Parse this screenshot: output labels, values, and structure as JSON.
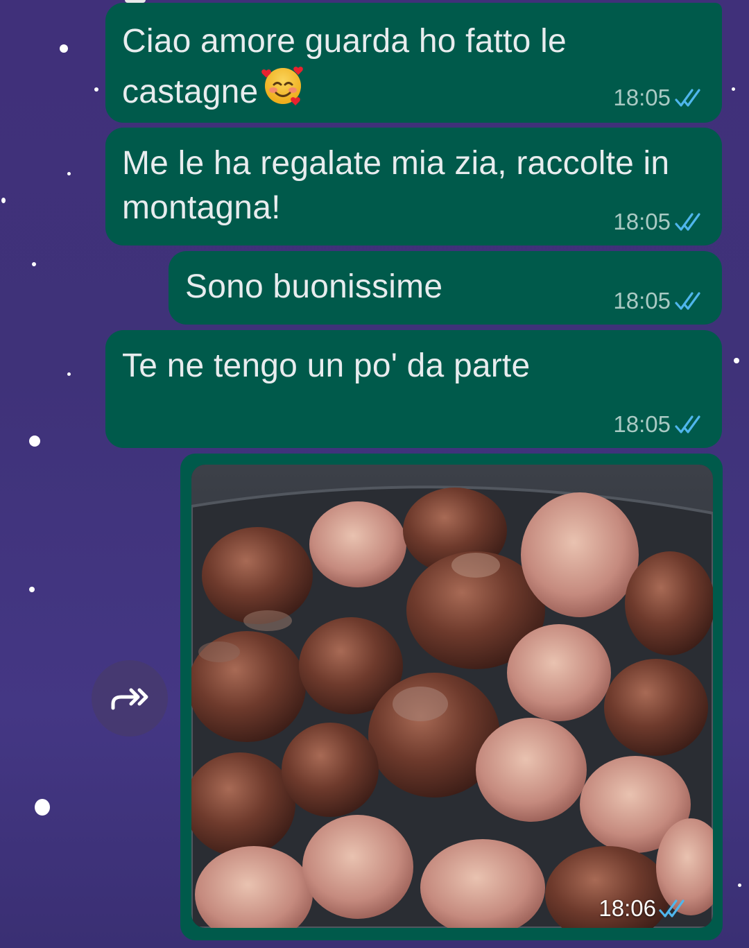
{
  "chat": {
    "messages": [
      {
        "text": "Ciao amore guarda ho fatto le castagne",
        "emoji": "smiling-face-with-hearts",
        "time": "18:05",
        "status": "read"
      },
      {
        "text": "Me le ha regalate mia zia, raccolte in montagna!",
        "time": "18:05",
        "status": "read"
      },
      {
        "text": "Sono buonissime",
        "time": "18:05",
        "status": "read"
      },
      {
        "text": "Te ne tengo un po' da parte",
        "time": "18:05",
        "status": "read"
      }
    ],
    "photo_message": {
      "content": "photo of roasted chestnuts in a pan",
      "time": "18:06",
      "status": "read"
    }
  },
  "icons": {
    "read_receipt": "double-check-icon",
    "forward": "forward-icon",
    "emoji": "smiling-face-with-hearts-icon"
  },
  "colors": {
    "background": "#40307a",
    "bubble_outgoing": "#005a4b",
    "bubble_text": "#e8ecee",
    "timestamp": "#aacac4",
    "read_tick": "#4fb6ec"
  }
}
